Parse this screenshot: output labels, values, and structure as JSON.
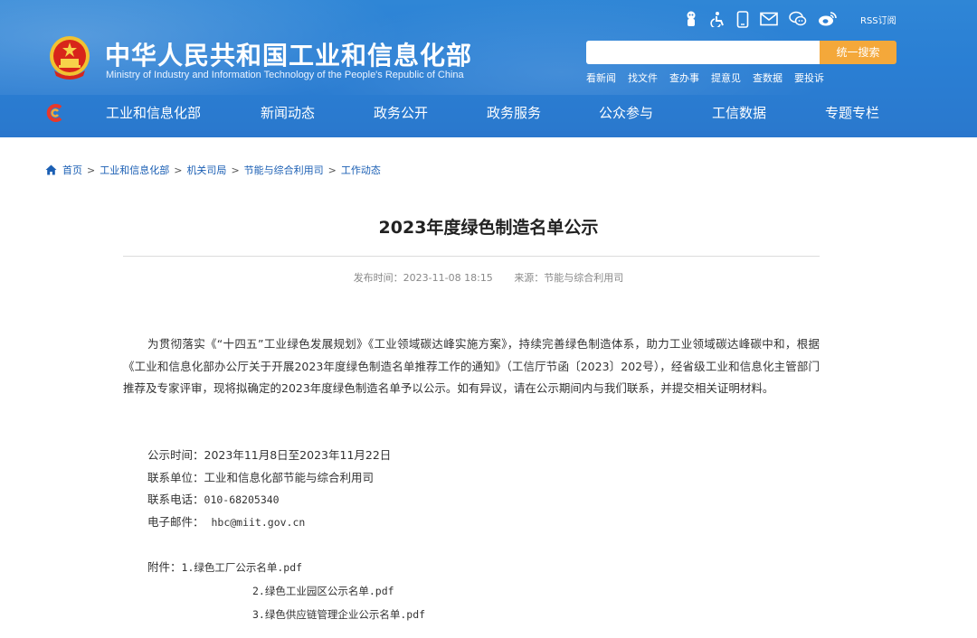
{
  "header": {
    "site_title": "中华人民共和国工业和信息化部",
    "site_subtitle": "Ministry of Industry and Information Technology of the People's Republic of China",
    "top_icons": [
      "mascot-icon",
      "accessibility-icon",
      "mobile-icon",
      "mail-icon",
      "wechat-icon",
      "weibo-icon",
      "rss-icon"
    ],
    "rss_label": "RSS订阅",
    "search": {
      "placeholder": "",
      "button_label": "统一搜索"
    },
    "quick_links": [
      "看新闻",
      "找文件",
      "查办事",
      "提意见",
      "查数据",
      "要投诉"
    ],
    "brand_colors": {
      "header_blue": "#2a7fd4",
      "search_orange": "#f4a83a",
      "link_blue": "#1b5fb4"
    }
  },
  "nav": {
    "items": [
      "工业和信息化部",
      "新闻动态",
      "政务公开",
      "政务服务",
      "公众参与",
      "工信数据",
      "专题专栏"
    ]
  },
  "breadcrumb": {
    "items": [
      "首页",
      "工业和信息化部",
      "机关司局",
      "节能与综合利用司",
      "工作动态"
    ],
    "separator": ">"
  },
  "article": {
    "title": "2023年度绿色制造名单公示",
    "publish_label": "发布时间：2023-11-08 18:15",
    "source_label": "来源：节能与综合利用司",
    "body": "为贯彻落实《“十四五”工业绿色发展规划》《工业领域碳达峰实施方案》，持续完善绿色制造体系，助力工业领域碳达峰碳中和，根据《工业和信息化部办公厅关于开展2023年度绿色制造名单推荐工作的通知》（工信厅节函〔2023〕202号），经省级工业和信息化主管部门推荐及专家评审，现将拟确定的2023年度绿色制造名单予以公示。如有异议，请在公示期间内与我们联系，并提交相关证明材料。",
    "info": {
      "period_label": "公示时间：",
      "period_value": "2023年11月8日至2023年11月22日",
      "contact_unit_label": "联系单位：",
      "contact_unit_value": "工业和信息化部节能与综合利用司",
      "phone_label": "联系电话：",
      "phone_value": "010-68205340",
      "email_label": "电子邮件：",
      "email_value": "hbc@miit.gov.cn"
    },
    "attachments_label": "附件：",
    "attachments": [
      "1.绿色工厂公示名单.pdf",
      "2.绿色工业园区公示名单.pdf",
      "3.绿色供应链管理企业公示名单.pdf"
    ]
  }
}
